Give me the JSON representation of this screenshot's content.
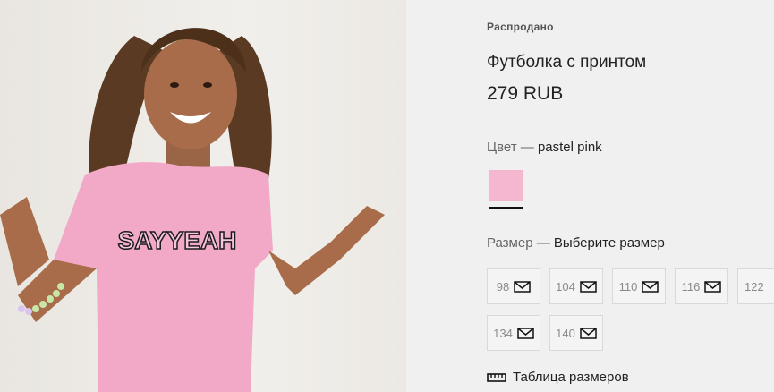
{
  "product": {
    "status": "Распродано",
    "title": "Футболка с принтом",
    "price": "279 RUB",
    "shirt_print": "SAYYEAH"
  },
  "color": {
    "label": "Цвет —",
    "value": "pastel pink",
    "swatch_hex": "#f5b6d0"
  },
  "size": {
    "label": "Размер —",
    "prompt": "Выберите размер",
    "options": [
      "98",
      "104",
      "110",
      "116",
      "122",
      "134",
      "140"
    ],
    "icon": "envelope-icon"
  },
  "size_table": {
    "label": "Таблица размеров",
    "icon": "ruler-icon"
  }
}
